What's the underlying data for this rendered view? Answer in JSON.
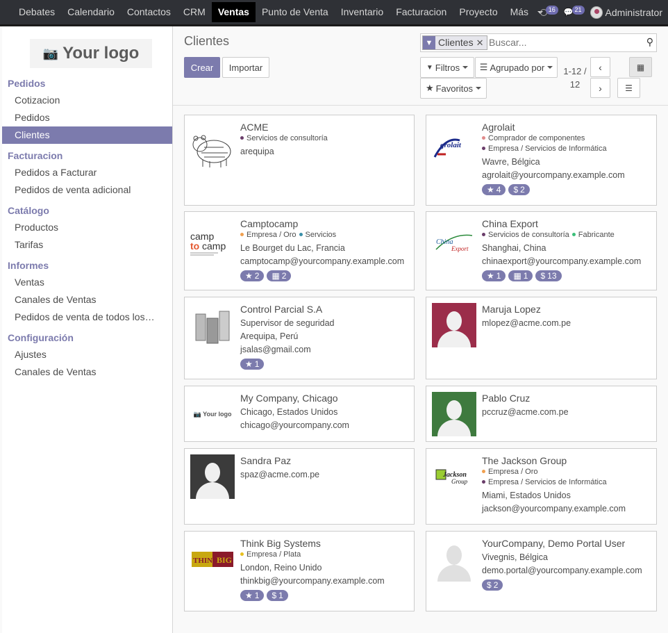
{
  "topbar": {
    "menu": [
      "Debates",
      "Calendario",
      "Contactos",
      "CRM",
      "Ventas",
      "Punto de Venta",
      "Inventario",
      "Facturacion",
      "Proyecto",
      "Más"
    ],
    "active": "Ventas",
    "notif_count": "16",
    "chat_count": "21",
    "user": "Administrator"
  },
  "sidebar": {
    "logo_text": "Your logo",
    "sections": [
      {
        "title": "Pedidos",
        "items": [
          "Cotizacion",
          "Pedidos",
          "Clientes"
        ]
      },
      {
        "title": "Facturacion",
        "items": [
          "Pedidos a Facturar",
          "Pedidos de venta adicional"
        ]
      },
      {
        "title": "Catálogo",
        "items": [
          "Productos",
          "Tarifas"
        ]
      },
      {
        "title": "Informes",
        "items": [
          "Ventas",
          "Canales de Ventas",
          "Pedidos de venta de todos los…"
        ]
      },
      {
        "title": "Configuración",
        "items": [
          "Ajustes",
          "Canales de Ventas"
        ]
      }
    ],
    "active_item": "Clientes"
  },
  "control": {
    "title": "Clientes",
    "create": "Crear",
    "import": "Importar",
    "facet": "Clientes",
    "search_placeholder": "Buscar...",
    "filters": "Filtros",
    "group_by": "Agrupado por",
    "favorites": "Favoritos",
    "pager_range": "1-12 /",
    "pager_total": "12"
  },
  "cards": [
    {
      "name": "ACME",
      "tags": [
        {
          "label": "Servicios de consultoría",
          "color": "#6a3d6a"
        }
      ],
      "lines": [
        "arequipa"
      ],
      "pills": [],
      "image": "bear"
    },
    {
      "name": "Agrolait",
      "tags": [
        {
          "label": "Comprador de componentes",
          "color": "#e08a8a"
        },
        {
          "label": "Empresa / Servicios de Informática",
          "color": "#6a3d6a"
        }
      ],
      "lines": [
        "Wavre, Bélgica",
        "agrolait@yourcompany.example.com"
      ],
      "pills": [
        {
          "icon": "★",
          "value": "4"
        },
        {
          "icon": "$",
          "value": "2"
        }
      ],
      "image": "agrolait"
    },
    {
      "name": "Camptocamp",
      "tags": [
        {
          "label": "Empresa / Oro",
          "color": "#f0a050"
        },
        {
          "label": "Servicios",
          "color": "#3a8fa8"
        }
      ],
      "tags_inline": true,
      "lines": [
        "Le Bourget du Lac, Francia",
        "camptocamp@yourcompany.example.com"
      ],
      "pills": [
        {
          "icon": "★",
          "value": "2"
        },
        {
          "icon": "▦",
          "value": "2"
        }
      ],
      "image": "camptocamp"
    },
    {
      "name": "China Export",
      "tags": [
        {
          "label": "Servicios de consultoría",
          "color": "#6a3d6a"
        },
        {
          "label": "Fabricante",
          "color": "#3cbf7a"
        }
      ],
      "tags_inline": true,
      "lines": [
        "Shanghai, China",
        "chinaexport@yourcompany.example.com"
      ],
      "pills": [
        {
          "icon": "★",
          "value": "1"
        },
        {
          "icon": "▦",
          "value": "1"
        },
        {
          "icon": "$",
          "value": "13"
        }
      ],
      "image": "china"
    },
    {
      "name": "Control Parcial S.A",
      "tags": [],
      "lines": [
        "Supervisor de seguridad",
        "Arequipa, Perú",
        "jsalas@gmail.com"
      ],
      "pills": [
        {
          "icon": "★",
          "value": "1"
        }
      ],
      "image": "buildings"
    },
    {
      "name": "Maruja Lopez",
      "tags": [],
      "lines": [
        "mlopez@acme.com.pe"
      ],
      "pills": [],
      "image": "person-red"
    },
    {
      "name": "My Company, Chicago",
      "tags": [],
      "lines": [
        "Chicago, Estados Unidos",
        "chicago@yourcompany.com"
      ],
      "pills": [],
      "image": "yourlogo",
      "image_text": "Your logo"
    },
    {
      "name": "Pablo Cruz",
      "tags": [],
      "lines": [
        "pccruz@acme.com.pe"
      ],
      "pills": [],
      "image": "person-green"
    },
    {
      "name": "Sandra Paz",
      "tags": [],
      "lines": [
        "spaz@acme.com.pe"
      ],
      "pills": [],
      "image": "person-dark"
    },
    {
      "name": "The Jackson Group",
      "tags": [
        {
          "label": "Empresa / Oro",
          "color": "#f0a050"
        },
        {
          "label": "Empresa / Servicios de Informática",
          "color": "#6a3d6a"
        }
      ],
      "lines": [
        "Miami, Estados Unidos",
        "jackson@yourcompany.example.com"
      ],
      "pills": [],
      "image": "jackson"
    },
    {
      "name": "Think Big Systems",
      "tags": [
        {
          "label": "Empresa / Plata",
          "color": "#e8c020"
        }
      ],
      "lines": [
        "London, Reino Unido",
        "thinkbig@yourcompany.example.com"
      ],
      "pills": [
        {
          "icon": "★",
          "value": "1"
        },
        {
          "icon": "$",
          "value": "1"
        }
      ],
      "image": "thinkbig"
    },
    {
      "name": "YourCompany, Demo Portal User",
      "tags": [],
      "lines": [
        "Vivegnis, Bélgica",
        "demo.portal@yourcompany.example.com"
      ],
      "pills": [
        {
          "icon": "$",
          "value": "2"
        }
      ],
      "image": "person-white"
    }
  ]
}
